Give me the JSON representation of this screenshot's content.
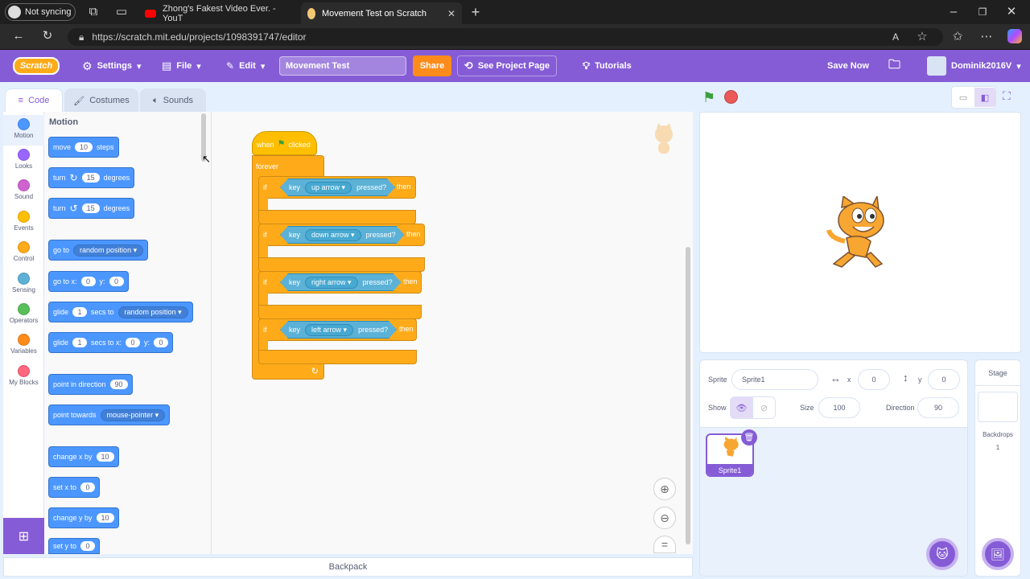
{
  "browser": {
    "profile_label": "Not syncing",
    "tabs": [
      {
        "title": "Zhong's Fakest Video Ever. - YouT",
        "active": false
      },
      {
        "title": "Movement Test on Scratch",
        "active": true
      }
    ],
    "url": "https://scratch.mit.edu/projects/1098391747/editor"
  },
  "menu": {
    "logo": "Scratch",
    "settings": "Settings",
    "file": "File",
    "edit": "Edit",
    "project_title": "Movement Test",
    "share": "Share",
    "see_project_page": "See Project Page",
    "tutorials": "Tutorials",
    "save_now": "Save Now",
    "username": "Dominik2016V"
  },
  "editor_tabs": {
    "code": "Code",
    "costumes": "Costumes",
    "sounds": "Sounds"
  },
  "categories": [
    {
      "label": "Motion",
      "color": "#4c97ff"
    },
    {
      "label": "Looks",
      "color": "#9966ff"
    },
    {
      "label": "Sound",
      "color": "#cf63cf"
    },
    {
      "label": "Events",
      "color": "#ffbf00"
    },
    {
      "label": "Control",
      "color": "#ffab19"
    },
    {
      "label": "Sensing",
      "color": "#5cb1d6"
    },
    {
      "label": "Operators",
      "color": "#59c059"
    },
    {
      "label": "Variables",
      "color": "#ff8c1a"
    },
    {
      "label": "My Blocks",
      "color": "#ff6680"
    }
  ],
  "palette": {
    "heading": "Motion",
    "move": {
      "a": "move",
      "n": "10",
      "b": "steps"
    },
    "turn_right": {
      "a": "turn",
      "n": "15",
      "b": "degrees"
    },
    "turn_left": {
      "a": "turn",
      "n": "15",
      "b": "degrees"
    },
    "goto": {
      "a": "go to",
      "d": "random position"
    },
    "goto_xy": {
      "a": "go to x:",
      "x": "0",
      "b": "y:",
      "y": "0"
    },
    "glide_to": {
      "a": "glide",
      "n": "1",
      "b": "secs to",
      "d": "random position"
    },
    "glide_xy": {
      "a": "glide",
      "n": "1",
      "b": "secs to x:",
      "x": "0",
      "c": "y:",
      "y": "0"
    },
    "point_dir": {
      "a": "point in direction",
      "n": "90"
    },
    "point_towards": {
      "a": "point towards",
      "d": "mouse-pointer"
    },
    "change_x": {
      "a": "change x by",
      "n": "10"
    },
    "set_x": {
      "a": "set x to",
      "n": "0"
    },
    "change_y": {
      "a": "change y by",
      "n": "10"
    },
    "set_y": {
      "a": "set y to",
      "n": "0"
    }
  },
  "script": {
    "hat_when": "when",
    "hat_clicked": "clicked",
    "forever": "forever",
    "ifs": [
      {
        "if": "if",
        "key": "key",
        "option": "up arrow",
        "pressed": "pressed?",
        "then": "then"
      },
      {
        "if": "if",
        "key": "key",
        "option": "down arrow",
        "pressed": "pressed?",
        "then": "then"
      },
      {
        "if": "if",
        "key": "key",
        "option": "right arrow",
        "pressed": "pressed?",
        "then": "then"
      },
      {
        "if": "if",
        "key": "key",
        "option": "left arrow",
        "pressed": "pressed?",
        "then": "then"
      }
    ]
  },
  "zoom_equal": "=",
  "backpack": "Backpack",
  "sprite_info": {
    "sprite_label": "Sprite",
    "sprite_name": "Sprite1",
    "x_label": "x",
    "x": "0",
    "y_label": "y",
    "y": "0",
    "show_label": "Show",
    "size_label": "Size",
    "size": "100",
    "direction_label": "Direction",
    "direction": "90"
  },
  "sprite_tile": "Sprite1",
  "stage_pane": {
    "title": "Stage",
    "backdrops_label": "Backdrops",
    "backdrops_count": "1"
  }
}
